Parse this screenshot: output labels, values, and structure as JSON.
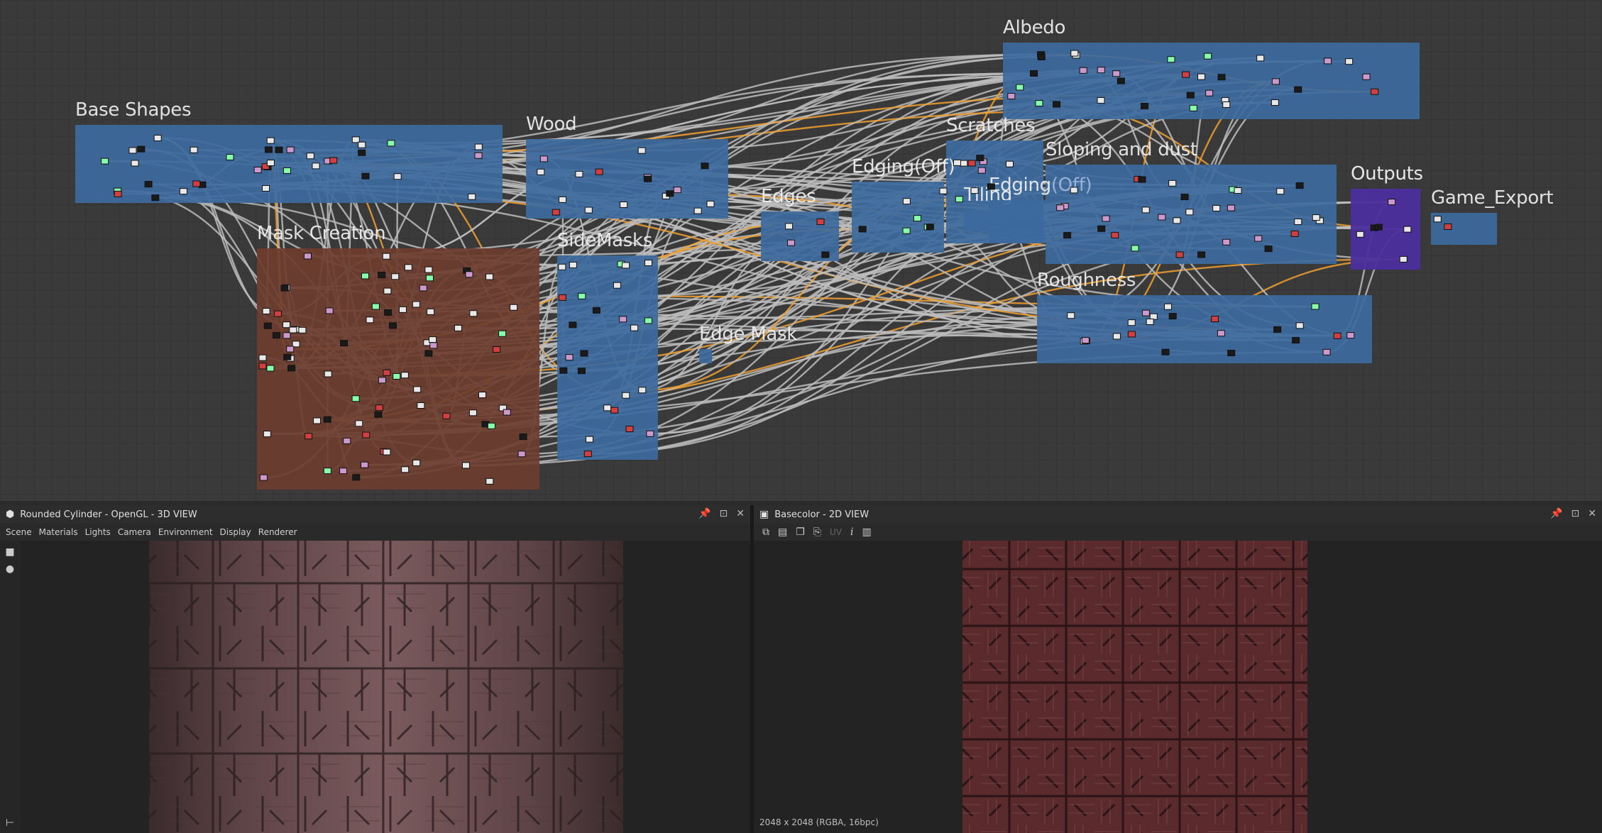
{
  "graph": {
    "frames": [
      {
        "id": "albedo",
        "title": "Albedo",
        "color": "#3d6a9e"
      },
      {
        "id": "base",
        "title": "Base Shapes",
        "color": "#3d6a9e"
      },
      {
        "id": "wood",
        "title": "Wood",
        "color": "#3d6a9e"
      },
      {
        "id": "scratches",
        "title": "Scratches",
        "color": "#3d6a9e"
      },
      {
        "id": "sloping",
        "title": "Sloping and dust",
        "color": "#3d6a9e"
      },
      {
        "id": "edgingoff",
        "title": "Edging(Off)",
        "color": "#3d6a9e"
      },
      {
        "id": "tiling",
        "title": "Tiling",
        "color": "#3d6a9e"
      },
      {
        "id": "edging2",
        "title": "Edging",
        "title_dim": "(Off)",
        "color": "#3d6a9e"
      },
      {
        "id": "edges",
        "title": "Edges",
        "color": "#3d6a9e"
      },
      {
        "id": "outputs",
        "title": "Outputs",
        "color": "#4b2f9e"
      },
      {
        "id": "gameexport",
        "title": "Game_Export",
        "color": "#3d6a9e"
      },
      {
        "id": "mask",
        "title": "Mask Creation",
        "color": "#6d3d2e"
      },
      {
        "id": "sidemasks",
        "title": "SideMasks",
        "color": "#3d6a9e"
      },
      {
        "id": "edgemask",
        "title": "Edge Mask",
        "color": "#3d6a9e"
      },
      {
        "id": "roughness",
        "title": "Roughness",
        "color": "#3d6a9e"
      }
    ],
    "wire_color": "#bdbdbd",
    "wire_accent": "#f0a030"
  },
  "view3d": {
    "title": "Rounded Cylinder - OpenGL - 3D VIEW",
    "menu": [
      "Scene",
      "Materials",
      "Lights",
      "Camera",
      "Environment",
      "Display",
      "Renderer"
    ],
    "side_icons": [
      "camera-icon",
      "light-bulb-icon"
    ],
    "pin": "📌",
    "max": "⊡",
    "close": "✕"
  },
  "view2d": {
    "title": "Basecolor - 2D VIEW",
    "toolbar": {
      "uv": "UV",
      "info": "i"
    },
    "status": "2048 x 2048 (RGBA, 16bpc)",
    "pin": "📌",
    "max": "⊡",
    "close": "✕"
  }
}
